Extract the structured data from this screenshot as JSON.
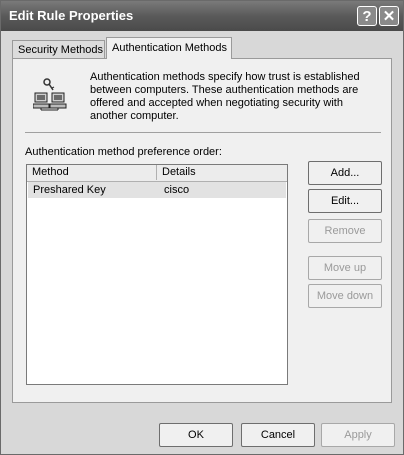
{
  "window": {
    "title": "Edit Rule Properties",
    "help_label": "?",
    "close_label": "✕"
  },
  "tabs": [
    {
      "label": "Security Methods",
      "active": false
    },
    {
      "label": "Authentication Methods",
      "active": true
    }
  ],
  "panel": {
    "icon": "networked-computers-key-icon",
    "description": "Authentication methods specify how trust is established between computers. These authentication methods are offered and accepted when negotiating security with another computer.",
    "list_label": "Authentication method preference order:",
    "columns": [
      "Method",
      "Details"
    ],
    "rows": [
      {
        "method": "Preshared Key",
        "details": "cisco",
        "selected": true
      }
    ],
    "buttons": {
      "add": "Add...",
      "edit": "Edit...",
      "remove": "Remove",
      "move_up": "Move up",
      "move_down": "Move down"
    }
  },
  "footer": {
    "ok": "OK",
    "cancel": "Cancel",
    "apply": "Apply"
  }
}
